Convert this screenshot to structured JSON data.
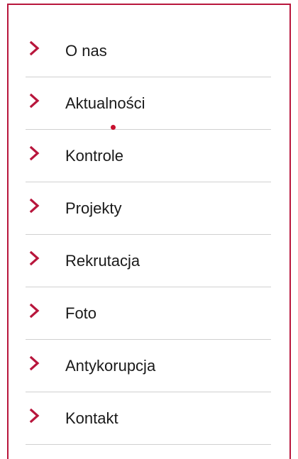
{
  "menu": {
    "accent_color": "#b8163c",
    "items": [
      {
        "label": "O nas",
        "icon": "chevron-right-icon"
      },
      {
        "label": "Aktualności",
        "icon": "chevron-right-icon"
      },
      {
        "label": "Kontrole",
        "icon": "chevron-right-icon"
      },
      {
        "label": "Projekty",
        "icon": "chevron-right-icon"
      },
      {
        "label": "Rekrutacja",
        "icon": "chevron-right-icon"
      },
      {
        "label": "Foto",
        "icon": "chevron-right-icon"
      },
      {
        "label": "Antykorupcja",
        "icon": "chevron-right-icon"
      },
      {
        "label": "Kontakt",
        "icon": "chevron-right-icon"
      }
    ]
  }
}
